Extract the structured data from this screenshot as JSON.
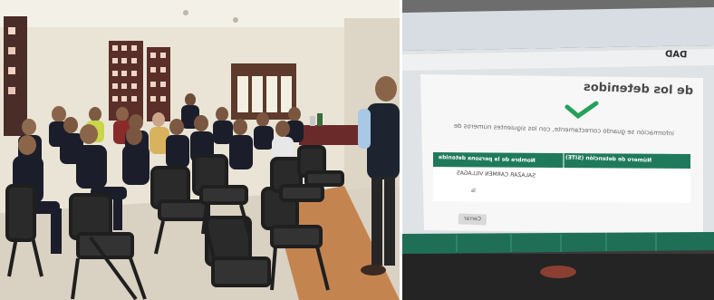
{
  "image": {
    "left_panel": "photograph",
    "right_panel": "photograph"
  },
  "screen": {
    "brand_fragment": "DAD",
    "heading": "de los detenidos",
    "message": "información se guardó correctamente, con los siguientes números de",
    "table_headers": [
      "Número de detención (SITE)",
      "Nombre de la persona detenida"
    ],
    "detainee_name": "SALAZAR CARMEN VILLAGAS",
    "detainee_extra": "ls",
    "close_label": "Cerrar"
  },
  "colors": {
    "wall": "#e8e3d6",
    "tile_floor": "#c98a5a",
    "uniform": "#1c1f2b",
    "chair": "#2a2a2a",
    "screen_green": "#1f7a5c",
    "check_green": "#27a05a"
  }
}
